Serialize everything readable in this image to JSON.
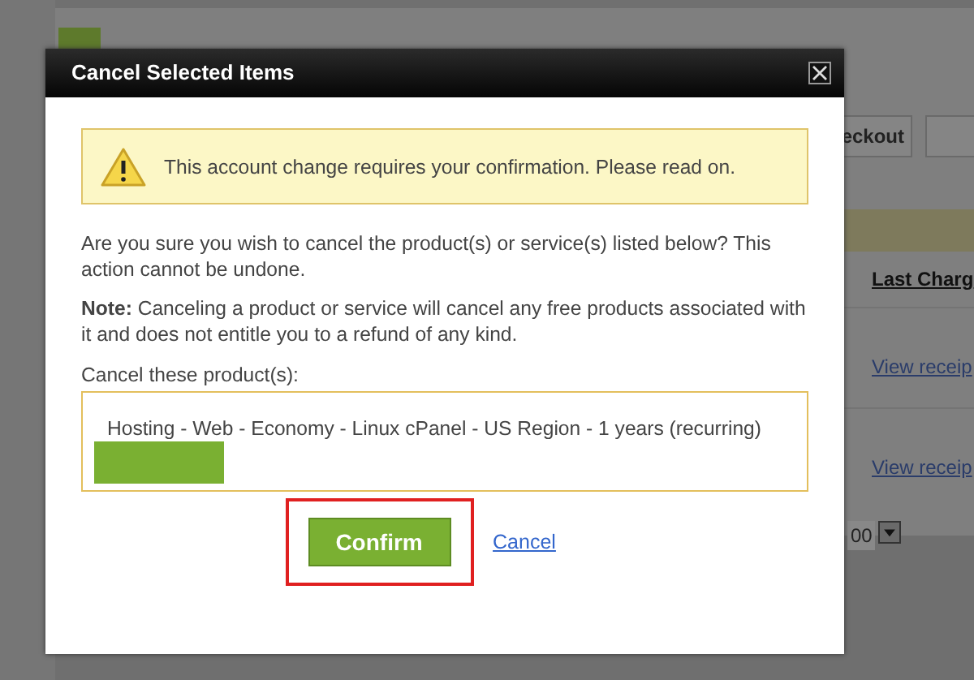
{
  "background": {
    "checkout_button": "eckout",
    "column_header": "Last Charg",
    "rows": [
      {
        "link": "View receip"
      },
      {
        "link": "View receip"
      }
    ],
    "per_page": "00"
  },
  "dialog": {
    "title": "Cancel Selected Items",
    "alert": "This account change requires your confirmation. Please read on.",
    "question": "Are you sure you wish to cancel the product(s) or service(s) listed below? This action cannot be undone.",
    "note": "**Note:** Canceling a product or service will cancel any free products associated with it and does not entitle you to a refund of any kind.",
    "list_label": "Cancel these product(s):",
    "products": [
      "Hosting - Web - Economy - Linux cPanel - US Region - 1 years (recurring)"
    ],
    "confirm": {
      "label": "Confirm",
      "highlighted": true
    },
    "cancel": "Cancel"
  }
}
